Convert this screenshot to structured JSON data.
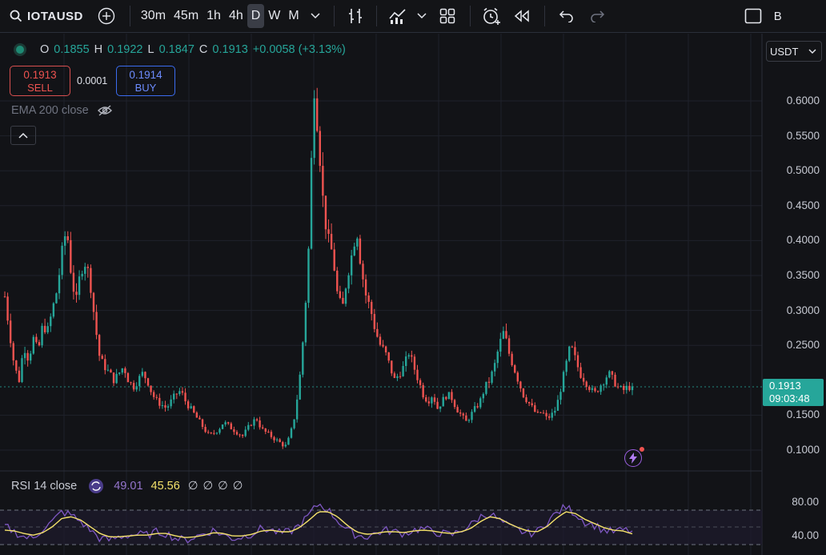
{
  "toolbar": {
    "symbol": "IOTAUSD",
    "timeframes": [
      "30m",
      "45m",
      "1h",
      "4h",
      "D",
      "W",
      "M"
    ],
    "active_timeframe": "D",
    "right_label": "B"
  },
  "legend": {
    "o_label": "O",
    "o_value": "0.1855",
    "h_label": "H",
    "h_value": "0.1922",
    "l_label": "L",
    "l_value": "0.1847",
    "c_label": "C",
    "c_value": "0.1913",
    "change": "+0.0058 (+3.13%)"
  },
  "trade": {
    "sell_price": "0.1913",
    "sell_label": "SELL",
    "spread": "0.0001",
    "buy_price": "0.1914",
    "buy_label": "BUY"
  },
  "indicator": {
    "ema_label": "EMA 200 close"
  },
  "currency_select": {
    "value": "USDT"
  },
  "last_price": {
    "value": "0.1913",
    "countdown": "09:03:48"
  },
  "rsi": {
    "label": "RSI 14 close",
    "value1": "49.01",
    "value2": "45.56",
    "nulls": "∅ ∅ ∅ ∅"
  },
  "colors": {
    "up": "#26a69a",
    "down": "#ef5350",
    "rsi_line": "#7e57c2",
    "rsi_ma": "#f5e26b",
    "accent": "#9b5ee0"
  },
  "chart_data": {
    "type": "line",
    "title": "",
    "series": [
      {
        "values": [
          0.32,
          0.27,
          0.22,
          0.2,
          0.25,
          0.23,
          0.26,
          0.24,
          0.28,
          0.27,
          0.3,
          0.33,
          0.38,
          0.42,
          0.35,
          0.31,
          0.36,
          0.37,
          0.34,
          0.28,
          0.23,
          0.22,
          0.21,
          0.2,
          0.21,
          0.22,
          0.2,
          0.19,
          0.2,
          0.21,
          0.2,
          0.18,
          0.17,
          0.165,
          0.16,
          0.17,
          0.18,
          0.185,
          0.17,
          0.16,
          0.15,
          0.14,
          0.13,
          0.12,
          0.125,
          0.13,
          0.14,
          0.135,
          0.13,
          0.125,
          0.12,
          0.13,
          0.14,
          0.145,
          0.13,
          0.125,
          0.12,
          0.115,
          0.11,
          0.105,
          0.12,
          0.15,
          0.2,
          0.28,
          0.4,
          0.63,
          0.55,
          0.45,
          0.4,
          0.38,
          0.32,
          0.3,
          0.35,
          0.38,
          0.42,
          0.36,
          0.32,
          0.3,
          0.27,
          0.25,
          0.24,
          0.22,
          0.2,
          0.21,
          0.22,
          0.24,
          0.22,
          0.2,
          0.18,
          0.17,
          0.18,
          0.16,
          0.17,
          0.18,
          0.175,
          0.16,
          0.15,
          0.14,
          0.15,
          0.16,
          0.17,
          0.19,
          0.2,
          0.22,
          0.25,
          0.27,
          0.24,
          0.22,
          0.2,
          0.18,
          0.17,
          0.16,
          0.15,
          0.155,
          0.145,
          0.15,
          0.16,
          0.19,
          0.22,
          0.25,
          0.23,
          0.21,
          0.2,
          0.19,
          0.18,
          0.19,
          0.2,
          0.21,
          0.2,
          0.19,
          0.185,
          0.19,
          0.1913
        ]
      }
    ],
    "ylim": [
      0.08,
      0.66
    ],
    "y_ticks": [
      "0.1000",
      "0.1500",
      "0.2500",
      "0.3000",
      "0.3500",
      "0.4000",
      "0.4500",
      "0.5000",
      "0.5500",
      "0.6000"
    ],
    "rsi_ticks": [
      "80.00",
      "40.00"
    ],
    "rsi_values": [
      55,
      48,
      42,
      40,
      52,
      60,
      72,
      68,
      60,
      50,
      40,
      38,
      42,
      44,
      45,
      44,
      48,
      46,
      40,
      38,
      42,
      46,
      50,
      44,
      40,
      42,
      46,
      52,
      50,
      46,
      48,
      56,
      68,
      82,
      74,
      62,
      50,
      44,
      42,
      46,
      50,
      48,
      46,
      50,
      52,
      48,
      46,
      44,
      50,
      56,
      66,
      70,
      62,
      54,
      50,
      46,
      48,
      60,
      70,
      78,
      70,
      60,
      56,
      50,
      48,
      50,
      49.01
    ],
    "rsi_ma_values": [
      50,
      49,
      46,
      44,
      47,
      54,
      64,
      66,
      62,
      54,
      46,
      42,
      42,
      43,
      44,
      44,
      46,
      46,
      43,
      41,
      42,
      44,
      47,
      46,
      43,
      43,
      45,
      49,
      50,
      48,
      48,
      53,
      62,
      72,
      72,
      66,
      56,
      48,
      45,
      46,
      48,
      48,
      47,
      49,
      50,
      49,
      47,
      46,
      48,
      52,
      60,
      66,
      64,
      58,
      53,
      49,
      48,
      54,
      64,
      72,
      70,
      63,
      58,
      53,
      50,
      49,
      45.56
    ],
    "rsi_ylim": [
      25,
      95
    ]
  }
}
